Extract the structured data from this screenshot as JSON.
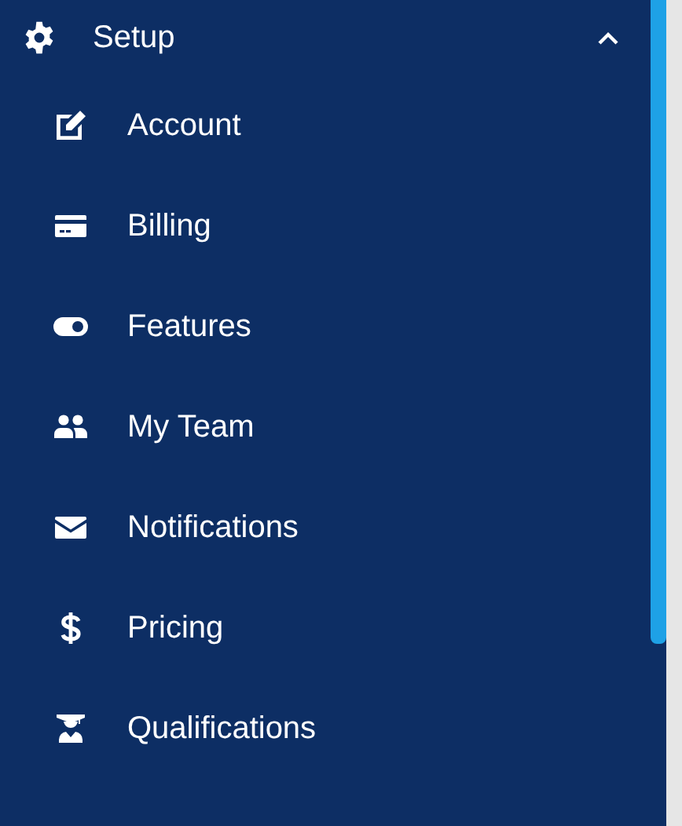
{
  "menu": {
    "label": "Setup",
    "expanded": true,
    "items": [
      {
        "label": "Account"
      },
      {
        "label": "Billing"
      },
      {
        "label": "Features"
      },
      {
        "label": "My Team"
      },
      {
        "label": "Notifications"
      },
      {
        "label": "Pricing"
      },
      {
        "label": "Qualifications"
      }
    ]
  }
}
